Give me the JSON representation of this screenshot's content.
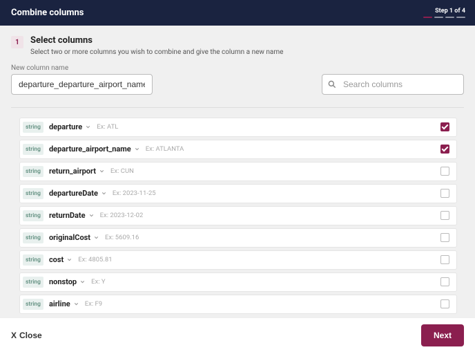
{
  "header": {
    "title": "Combine columns",
    "step_text": "Step 1 of 4",
    "current_step": 1,
    "total_steps": 4
  },
  "section": {
    "number": "1",
    "title": "Select columns",
    "subtitle": "Select two or more columns you wish to combine and give the column a new name"
  },
  "form": {
    "new_column_label": "New column name",
    "new_column_value": "departure_departure_airport_name"
  },
  "search": {
    "placeholder": "Search columns"
  },
  "columns": [
    {
      "type": "string",
      "name": "departure",
      "example": "Ex: ATL",
      "checked": true
    },
    {
      "type": "string",
      "name": "departure_airport_name",
      "example": "Ex: ATLANTA",
      "checked": true
    },
    {
      "type": "string",
      "name": "return_airport",
      "example": "Ex: CUN",
      "checked": false
    },
    {
      "type": "string",
      "name": "departureDate",
      "example": "Ex: 2023-11-25",
      "checked": false
    },
    {
      "type": "string",
      "name": "returnDate",
      "example": "Ex: 2023-12-02",
      "checked": false
    },
    {
      "type": "string",
      "name": "originalCost",
      "example": "Ex: 5609.16",
      "checked": false
    },
    {
      "type": "string",
      "name": "cost",
      "example": "Ex: 4805.81",
      "checked": false
    },
    {
      "type": "string",
      "name": "nonstop",
      "example": "Ex: Y",
      "checked": false
    },
    {
      "type": "string",
      "name": "airline",
      "example": "Ex: F9",
      "checked": false
    }
  ],
  "footer": {
    "close": "Close",
    "next": "Next"
  }
}
